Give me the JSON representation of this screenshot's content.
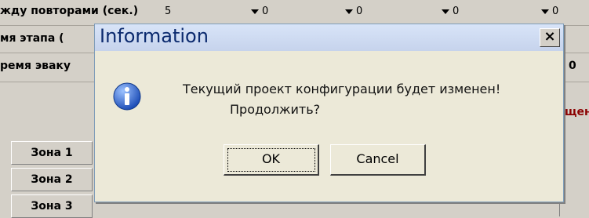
{
  "background": {
    "row1_label": "жду повторами (сек.)",
    "row2_label": "мя этапа (",
    "row3_label": "ремя эваку",
    "combo_values": [
      "5",
      "0",
      "0",
      "0",
      "0"
    ],
    "row3_right_value": "0",
    "right_partial_text": "щен",
    "zones": [
      "Зона 1",
      "Зона 2",
      "Зона 3"
    ]
  },
  "dialog": {
    "title": "Information",
    "close_label": "×",
    "message_line1": "Текущий проект конфигурации будет изменен!",
    "message_line2": "Продолжить?",
    "ok_label": "OK",
    "cancel_label": "Cancel"
  },
  "colors": {
    "dialog_bg": "#ece9d8",
    "title_text": "#0b2a6e",
    "info_icon": "#2a62c7",
    "alert_text": "#8b0000"
  },
  "icons": {
    "info": "info-icon",
    "close": "close-icon",
    "dropdown": "chevron-down-icon"
  }
}
